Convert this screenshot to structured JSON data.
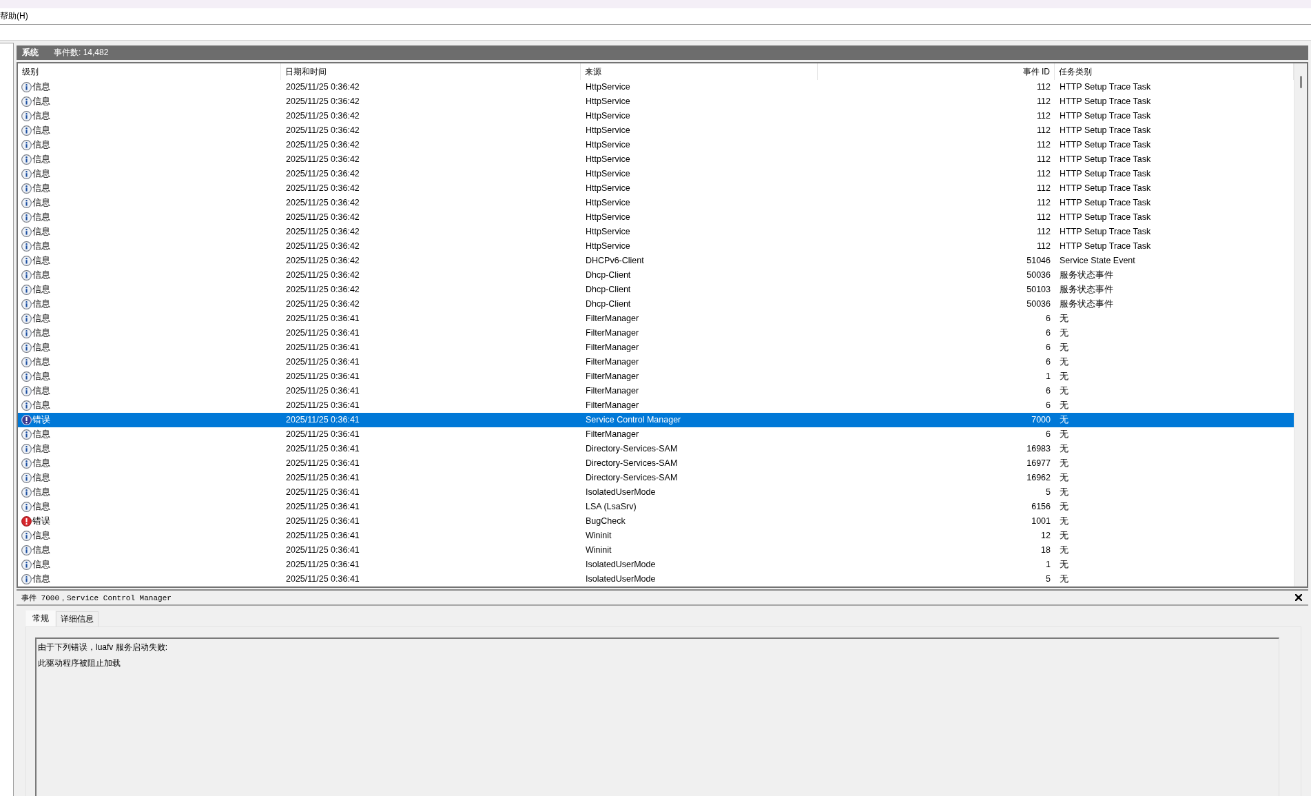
{
  "menu_bar": {
    "items": [
      "帮助(H)"
    ]
  },
  "log_header": {
    "title": "系统",
    "event_count": "事件数: 14,482"
  },
  "table": {
    "columns": [
      "级别",
      "日期和时间",
      "来源",
      "事件 ID",
      "任务类别"
    ],
    "rows": [
      {
        "kind": "info",
        "severity": "信息",
        "datetime": "2025/11/25 0:36:42",
        "source": "HttpService",
        "event_id": "112",
        "task_category": "HTTP Setup Trace Task",
        "selected": false
      },
      {
        "kind": "info",
        "severity": "信息",
        "datetime": "2025/11/25 0:36:42",
        "source": "HttpService",
        "event_id": "112",
        "task_category": "HTTP Setup Trace Task",
        "selected": false
      },
      {
        "kind": "info",
        "severity": "信息",
        "datetime": "2025/11/25 0:36:42",
        "source": "HttpService",
        "event_id": "112",
        "task_category": "HTTP Setup Trace Task",
        "selected": false
      },
      {
        "kind": "info",
        "severity": "信息",
        "datetime": "2025/11/25 0:36:42",
        "source": "HttpService",
        "event_id": "112",
        "task_category": "HTTP Setup Trace Task",
        "selected": false
      },
      {
        "kind": "info",
        "severity": "信息",
        "datetime": "2025/11/25 0:36:42",
        "source": "HttpService",
        "event_id": "112",
        "task_category": "HTTP Setup Trace Task",
        "selected": false
      },
      {
        "kind": "info",
        "severity": "信息",
        "datetime": "2025/11/25 0:36:42",
        "source": "HttpService",
        "event_id": "112",
        "task_category": "HTTP Setup Trace Task",
        "selected": false
      },
      {
        "kind": "info",
        "severity": "信息",
        "datetime": "2025/11/25 0:36:42",
        "source": "HttpService",
        "event_id": "112",
        "task_category": "HTTP Setup Trace Task",
        "selected": false
      },
      {
        "kind": "info",
        "severity": "信息",
        "datetime": "2025/11/25 0:36:42",
        "source": "HttpService",
        "event_id": "112",
        "task_category": "HTTP Setup Trace Task",
        "selected": false
      },
      {
        "kind": "info",
        "severity": "信息",
        "datetime": "2025/11/25 0:36:42",
        "source": "HttpService",
        "event_id": "112",
        "task_category": "HTTP Setup Trace Task",
        "selected": false
      },
      {
        "kind": "info",
        "severity": "信息",
        "datetime": "2025/11/25 0:36:42",
        "source": "HttpService",
        "event_id": "112",
        "task_category": "HTTP Setup Trace Task",
        "selected": false
      },
      {
        "kind": "info",
        "severity": "信息",
        "datetime": "2025/11/25 0:36:42",
        "source": "HttpService",
        "event_id": "112",
        "task_category": "HTTP Setup Trace Task",
        "selected": false
      },
      {
        "kind": "info",
        "severity": "信息",
        "datetime": "2025/11/25 0:36:42",
        "source": "HttpService",
        "event_id": "112",
        "task_category": "HTTP Setup Trace Task",
        "selected": false
      },
      {
        "kind": "info",
        "severity": "信息",
        "datetime": "2025/11/25 0:36:42",
        "source": "DHCPv6-Client",
        "event_id": "51046",
        "task_category": "Service State Event",
        "selected": false
      },
      {
        "kind": "info",
        "severity": "信息",
        "datetime": "2025/11/25 0:36:42",
        "source": "Dhcp-Client",
        "event_id": "50036",
        "task_category": "服务状态事件",
        "selected": false
      },
      {
        "kind": "info",
        "severity": "信息",
        "datetime": "2025/11/25 0:36:42",
        "source": "Dhcp-Client",
        "event_id": "50103",
        "task_category": "服务状态事件",
        "selected": false
      },
      {
        "kind": "info",
        "severity": "信息",
        "datetime": "2025/11/25 0:36:42",
        "source": "Dhcp-Client",
        "event_id": "50036",
        "task_category": "服务状态事件",
        "selected": false
      },
      {
        "kind": "info",
        "severity": "信息",
        "datetime": "2025/11/25 0:36:41",
        "source": "FilterManager",
        "event_id": "6",
        "task_category": "无",
        "selected": false
      },
      {
        "kind": "info",
        "severity": "信息",
        "datetime": "2025/11/25 0:36:41",
        "source": "FilterManager",
        "event_id": "6",
        "task_category": "无",
        "selected": false
      },
      {
        "kind": "info",
        "severity": "信息",
        "datetime": "2025/11/25 0:36:41",
        "source": "FilterManager",
        "event_id": "6",
        "task_category": "无",
        "selected": false
      },
      {
        "kind": "info",
        "severity": "信息",
        "datetime": "2025/11/25 0:36:41",
        "source": "FilterManager",
        "event_id": "6",
        "task_category": "无",
        "selected": false
      },
      {
        "kind": "info",
        "severity": "信息",
        "datetime": "2025/11/25 0:36:41",
        "source": "FilterManager",
        "event_id": "1",
        "task_category": "无",
        "selected": false
      },
      {
        "kind": "info",
        "severity": "信息",
        "datetime": "2025/11/25 0:36:41",
        "source": "FilterManager",
        "event_id": "6",
        "task_category": "无",
        "selected": false
      },
      {
        "kind": "info",
        "severity": "信息",
        "datetime": "2025/11/25 0:36:41",
        "source": "FilterManager",
        "event_id": "6",
        "task_category": "无",
        "selected": false
      },
      {
        "kind": "error",
        "severity": "错误",
        "datetime": "2025/11/25 0:36:41",
        "source": "Service Control Manager",
        "event_id": "7000",
        "task_category": "无",
        "selected": true
      },
      {
        "kind": "info",
        "severity": "信息",
        "datetime": "2025/11/25 0:36:41",
        "source": "FilterManager",
        "event_id": "6",
        "task_category": "无",
        "selected": false
      },
      {
        "kind": "info",
        "severity": "信息",
        "datetime": "2025/11/25 0:36:41",
        "source": "Directory-Services-SAM",
        "event_id": "16983",
        "task_category": "无",
        "selected": false
      },
      {
        "kind": "info",
        "severity": "信息",
        "datetime": "2025/11/25 0:36:41",
        "source": "Directory-Services-SAM",
        "event_id": "16977",
        "task_category": "无",
        "selected": false
      },
      {
        "kind": "info",
        "severity": "信息",
        "datetime": "2025/11/25 0:36:41",
        "source": "Directory-Services-SAM",
        "event_id": "16962",
        "task_category": "无",
        "selected": false
      },
      {
        "kind": "info",
        "severity": "信息",
        "datetime": "2025/11/25 0:36:41",
        "source": "IsolatedUserMode",
        "event_id": "5",
        "task_category": "无",
        "selected": false
      },
      {
        "kind": "info",
        "severity": "信息",
        "datetime": "2025/11/25 0:36:41",
        "source": "LSA (LsaSrv)",
        "event_id": "6156",
        "task_category": "无",
        "selected": false
      },
      {
        "kind": "error",
        "severity": "错误",
        "datetime": "2025/11/25 0:36:41",
        "source": "BugCheck",
        "event_id": "1001",
        "task_category": "无",
        "selected": false
      },
      {
        "kind": "info",
        "severity": "信息",
        "datetime": "2025/11/25 0:36:41",
        "source": "Wininit",
        "event_id": "12",
        "task_category": "无",
        "selected": false
      },
      {
        "kind": "info",
        "severity": "信息",
        "datetime": "2025/11/25 0:36:41",
        "source": "Wininit",
        "event_id": "18",
        "task_category": "无",
        "selected": false
      },
      {
        "kind": "info",
        "severity": "信息",
        "datetime": "2025/11/25 0:36:41",
        "source": "IsolatedUserMode",
        "event_id": "1",
        "task_category": "无",
        "selected": false
      },
      {
        "kind": "info",
        "severity": "信息",
        "datetime": "2025/11/25 0:36:41",
        "source": "IsolatedUserMode",
        "event_id": "5",
        "task_category": "无",
        "selected": false
      }
    ]
  },
  "details": {
    "title": "事件 7000，Service Control Manager",
    "tabs": [
      {
        "label": "常规",
        "selected": true
      },
      {
        "label": "详细信息",
        "selected": false
      }
    ],
    "description_lines": [
      "由于下列错误，luafv 服务启动失败:",
      "此驱动程序被阻止加载"
    ]
  }
}
